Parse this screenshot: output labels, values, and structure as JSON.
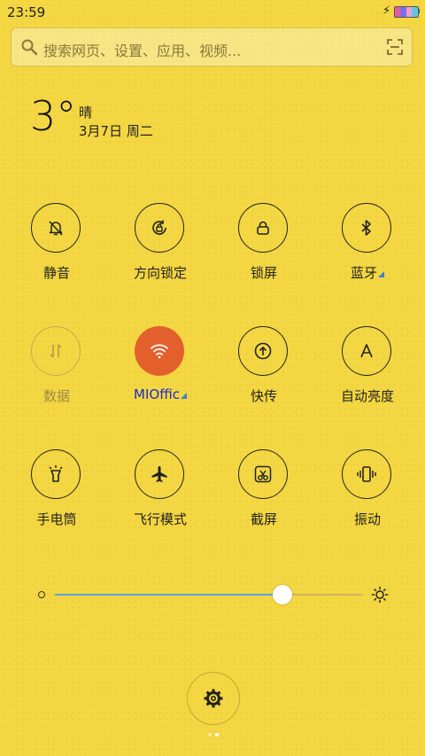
{
  "status": {
    "time": "23:59",
    "charging_icon": "bolt-icon"
  },
  "search": {
    "placeholder": "搜索网页、设置、应用、视频..."
  },
  "weather": {
    "temperature": "3°",
    "condition": "晴",
    "date": "3月7日 周二"
  },
  "toggles": [
    {
      "id": "mute",
      "label": "静音",
      "icon": "bell-mute-icon",
      "state": "off"
    },
    {
      "id": "rotation",
      "label": "方向锁定",
      "icon": "rotation-lock-icon",
      "state": "off"
    },
    {
      "id": "lock",
      "label": "锁屏",
      "icon": "lock-icon",
      "state": "off"
    },
    {
      "id": "bluetooth",
      "label": "蓝牙",
      "icon": "bluetooth-icon",
      "state": "off",
      "has_more": true
    },
    {
      "id": "data",
      "label": "数据",
      "icon": "data-arrows-icon",
      "state": "disabled"
    },
    {
      "id": "wifi",
      "label": "MIOffic",
      "icon": "wifi-icon",
      "state": "on",
      "has_more": true
    },
    {
      "id": "transfer",
      "label": "快传",
      "icon": "upload-icon",
      "state": "off"
    },
    {
      "id": "autobright",
      "label": "自动亮度",
      "icon": "auto-brightness-icon",
      "state": "off"
    },
    {
      "id": "flashlight",
      "label": "手电筒",
      "icon": "flashlight-icon",
      "state": "off"
    },
    {
      "id": "airplane",
      "label": "飞行模式",
      "icon": "airplane-icon",
      "state": "off"
    },
    {
      "id": "screenshot",
      "label": "截屏",
      "icon": "scissors-icon",
      "state": "off"
    },
    {
      "id": "vibrate",
      "label": "振动",
      "icon": "vibrate-icon",
      "state": "off"
    }
  ],
  "brightness": {
    "level": 0.74
  },
  "colors": {
    "accent": "#e3602c",
    "slider_fill": "#52a7de",
    "wifi_label": "#1c2bc8",
    "background": "#f3d640"
  },
  "pager": {
    "pages": 2,
    "current": 2
  }
}
